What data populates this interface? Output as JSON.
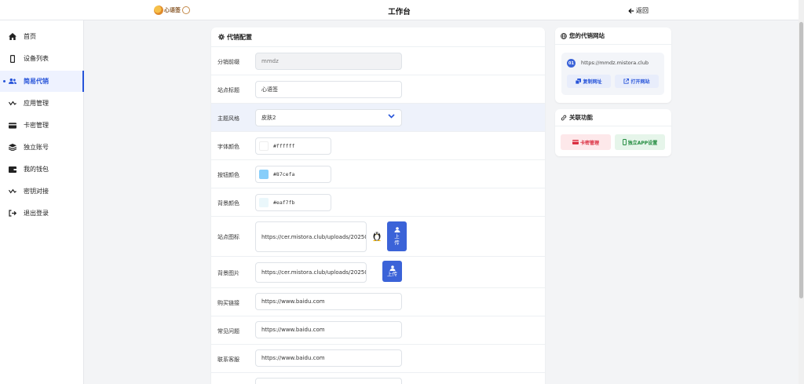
{
  "header": {
    "logo_text": "心语签",
    "title": "工作台",
    "back_label": "返回"
  },
  "sidebar": {
    "items": [
      {
        "label": "首页",
        "icon": "home-icon"
      },
      {
        "label": "设备列表",
        "icon": "phone-icon"
      },
      {
        "label": "简易代销",
        "icon": "users-icon",
        "active": true
      },
      {
        "label": "应用管理",
        "icon": "wave-icon"
      },
      {
        "label": "卡密管理",
        "icon": "card-icon"
      },
      {
        "label": "独立账号",
        "icon": "layers-icon"
      },
      {
        "label": "我的钱包",
        "icon": "wallet-icon"
      },
      {
        "label": "密钥对接",
        "icon": "wave-icon"
      },
      {
        "label": "退出登录",
        "icon": "logout-icon"
      }
    ]
  },
  "config": {
    "title": "代销配置",
    "prefix": {
      "label": "分销前缀",
      "value": "mmdz"
    },
    "site_title": {
      "label": "站点标题",
      "value": "心语签"
    },
    "theme": {
      "label": "主题风格",
      "value": "皮肤2"
    },
    "font_color": {
      "label": "字体颜色",
      "value": "#ffffff",
      "swatch": "#ffffff"
    },
    "button_color": {
      "label": "按钮颜色",
      "value": "#87cefa",
      "swatch": "#87cefa"
    },
    "bg_color": {
      "label": "背景颜色",
      "value": "#eaf7fb",
      "swatch": "#eaf7fb"
    },
    "site_icon": {
      "label": "站点图标",
      "value": "https://cer.mistora.club/uploads/20250",
      "upload_label": "上传"
    },
    "bg_image": {
      "label": "背景图片",
      "value": "https://cer.mistora.club/uploads/20250",
      "upload_label": "上传"
    },
    "buy_link": {
      "label": "购买链接",
      "value": "https://www.baidu.com"
    },
    "faq": {
      "label": "常见问题",
      "value": "https://www.baidu.com"
    },
    "support": {
      "label": "联系客服",
      "value": "https://www.baidu.com"
    }
  },
  "site_panel": {
    "title": "您的代销网站",
    "index": "01",
    "url": "https://mmdz.mistora.club",
    "copy_label": "复制网址",
    "open_label": "打开网站"
  },
  "related": {
    "title": "关联功能",
    "card_label": "卡密管理",
    "app_label": "独立APP设置"
  },
  "colors": {
    "accent": "#2754d9",
    "upload_button": "#3b63d8",
    "danger_bg": "#fde8ea",
    "danger_text": "#d9283b",
    "success_bg": "#e6f5ea",
    "success_text": "#1f8a3c"
  }
}
